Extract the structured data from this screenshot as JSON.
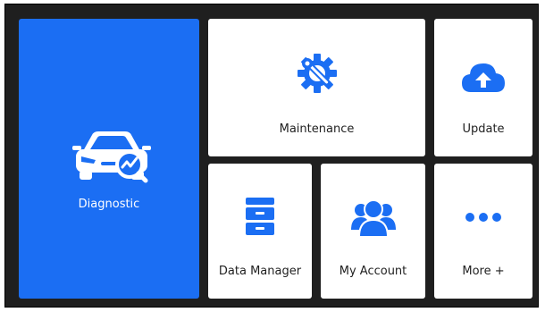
{
  "colors": {
    "accent": "#1b6ef3",
    "background": "#1f1f1f",
    "tile": "#ffffff"
  },
  "tiles": {
    "diagnostic": {
      "label": "Diagnostic",
      "icon": "car-diagnostic-icon"
    },
    "maintenance": {
      "label": "Maintenance",
      "icon": "wrench-gear-icon"
    },
    "update": {
      "label": "Update",
      "icon": "cloud-upload-icon"
    },
    "data_manager": {
      "label": "Data Manager",
      "icon": "file-cabinet-icon"
    },
    "my_account": {
      "label": "My Account",
      "icon": "users-icon"
    },
    "more": {
      "label": "More +",
      "icon": "more-dots-icon"
    }
  }
}
